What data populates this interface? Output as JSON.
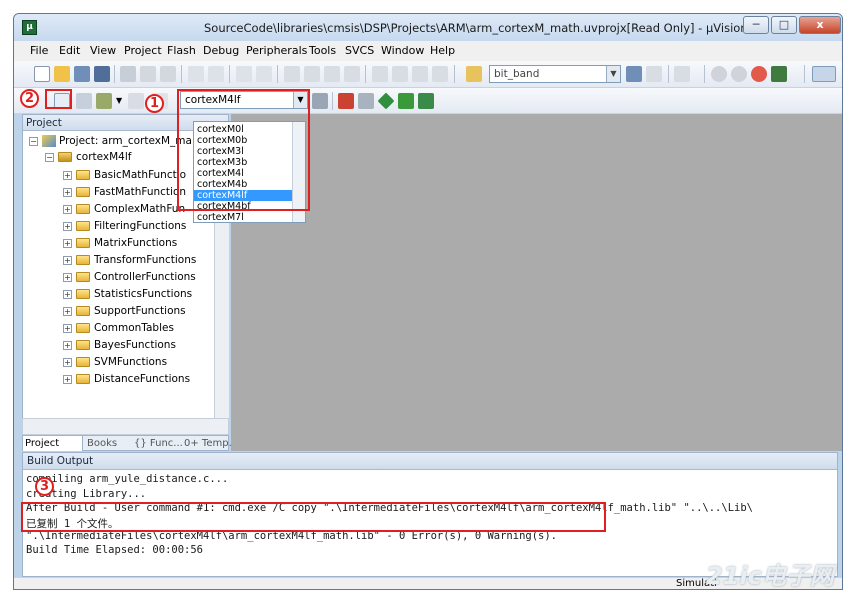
{
  "window": {
    "title": "SourceCode\\libraries\\cmsis\\DSP\\Projects\\ARM\\arm_cortexM_math.uvprojx[Read Only] - µVision",
    "minimize_label": "─",
    "maximize_label": "□",
    "close_label": "x"
  },
  "menu": [
    "File",
    "Edit",
    "View",
    "Project",
    "Flash",
    "Debug",
    "Peripherals",
    "Tools",
    "SVCS",
    "Window",
    "Help"
  ],
  "toolbar": {
    "find_value": "bit_band",
    "target_value": "cortexM4lf"
  },
  "dropdown": {
    "options": [
      "cortexM0l",
      "cortexM0b",
      "cortexM3l",
      "cortexM3b",
      "cortexM4l",
      "cortexM4b",
      "cortexM4lf",
      "cortexM4bf",
      "cortexM7l"
    ],
    "selected": "cortexM4lf"
  },
  "project_panel": {
    "title": "Project",
    "root": "Project: arm_cortexM_ma",
    "target": "cortexM4lf",
    "groups": [
      "BasicMathFunctio",
      "FastMathFunction",
      "ComplexMathFun",
      "FilteringFunctions",
      "MatrixFunctions",
      "TransformFunctions",
      "ControllerFunctions",
      "StatisticsFunctions",
      "SupportFunctions",
      "CommonTables",
      "BayesFunctions",
      "SVMFunctions",
      "DistanceFunctions"
    ],
    "tabs": [
      "Project",
      "Books",
      "{} Func...",
      "0+ Temp..."
    ]
  },
  "build_output": {
    "title": "Build Output",
    "lines": [
      "compiling arm_yule_distance.c...",
      "creating Library...",
      "After Build - User command #1: cmd.exe /C copy \".\\IntermediateFiles\\cortexM4lf\\arm_cortexM4lf_math.lib\" \"..\\..\\Lib\\",
      "已复制         1 个文件。",
      "\".\\IntermediateFiles\\cortexM4lf\\arm_cortexM4lf_math.lib\" - 0 Error(s), 0 Warning(s).",
      "Build Time Elapsed:  00:00:56"
    ]
  },
  "status": {
    "simulation": "Simulati"
  },
  "annotations": {
    "one": "1",
    "two": "2",
    "three": "3"
  },
  "watermark": "21ic电子网",
  "colors": {
    "annotation_red": "#e02020",
    "selection_blue": "#3399ff",
    "editor_gray": "#ababab"
  }
}
